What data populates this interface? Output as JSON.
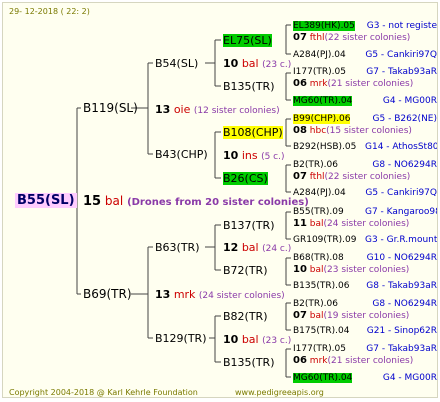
{
  "header": {
    "date": "29- 12-2018 ( 22: 2)"
  },
  "root": {
    "name": "B55(SL)",
    "count": "15",
    "race": "bal",
    "note": "(Drones from 20 sister colonies)"
  },
  "g1": {
    "top": "B119(SL)",
    "bottom": "B69(TR)"
  },
  "g2": [
    "B54(SL)",
    "B43(CHP)",
    "B63(TR)",
    "B129(TR)"
  ],
  "g2n": [
    {
      "n": "13",
      "r": "oie",
      "s": "(12 sister colonies)"
    },
    {
      "n": "13",
      "r": "mrk",
      "s": "(24 sister colonies)"
    }
  ],
  "g3": [
    "EL75(SL)",
    "B135(TR)",
    "B108(CHP)",
    "B26(CS)",
    "B137(TR)",
    "B72(TR)",
    "B82(TR)",
    "B135(TR)"
  ],
  "g3n": [
    {
      "n": "10",
      "r": "bal",
      "s": "(23 c.)"
    },
    {
      "n": "10",
      "r": "ins",
      "s": "(5 c.)"
    },
    {
      "n": "12",
      "r": "bal",
      "s": "(24 c.)"
    },
    {
      "n": "10",
      "r": "bal",
      "s": "(23 c.)"
    }
  ],
  "leaves": [
    {
      "type": "id",
      "name": "EL389(HK).05",
      "hl": "gn",
      "right": "G3 - not registe"
    },
    {
      "type": "note",
      "n": "07",
      "r": "fthl",
      "s": "(22 sister colonies)"
    },
    {
      "type": "id",
      "name": "A284(PJ).04",
      "hl": "",
      "right": "G5 - Cankiri97Q"
    },
    {
      "type": "id",
      "name": "I177(TR).05",
      "hl": "",
      "right": "G7 - Takab93aR"
    },
    {
      "type": "note",
      "n": "06",
      "r": "mrk",
      "s": "(21 sister colonies)"
    },
    {
      "type": "id",
      "name": "MG60(TR).04",
      "hl": "gn",
      "right": "G4 - MG00R"
    },
    {
      "type": "id",
      "name": "B99(CHP).06",
      "hl": "yl",
      "right": "G5 - B262(NE)"
    },
    {
      "type": "note",
      "n": "08",
      "r": "hbc",
      "s": "(15 sister colonies)"
    },
    {
      "type": "id",
      "name": "B292(HSB).05",
      "hl": "",
      "right": "G14 - AthosSt80R"
    },
    {
      "type": "id",
      "name": "B2(TR).06",
      "hl": "",
      "right": "G8 - NO6294R"
    },
    {
      "type": "note",
      "n": "07",
      "r": "fthl",
      "s": "(22 sister colonies)"
    },
    {
      "type": "id",
      "name": "A284(PJ).04",
      "hl": "",
      "right": "G5 - Cankiri97Q"
    },
    {
      "type": "id",
      "name": "B55(TR).09",
      "hl": "",
      "right": "G7 - Kangaroo98R"
    },
    {
      "type": "note",
      "n": "11",
      "r": "bal",
      "s": "(24 sister colonies)"
    },
    {
      "type": "id",
      "name": "GR109(TR).09",
      "hl": "",
      "right": "G3 - Gr.R.mounta"
    },
    {
      "type": "id",
      "name": "B68(TR).08",
      "hl": "",
      "right": "G10 - NO6294R"
    },
    {
      "type": "note",
      "n": "10",
      "r": "bal",
      "s": "(23 sister colonies)"
    },
    {
      "type": "id",
      "name": "B135(TR).06",
      "hl": "",
      "right": "G8 - Takab93aR"
    },
    {
      "type": "id",
      "name": "B2(TR).06",
      "hl": "",
      "right": "G8 - NO6294R"
    },
    {
      "type": "note",
      "n": "07",
      "r": "bal",
      "s": "(19 sister colonies)"
    },
    {
      "type": "id",
      "name": "B175(TR).04",
      "hl": "",
      "right": "G21 - Sinop62R"
    },
    {
      "type": "id",
      "name": "I177(TR).05",
      "hl": "",
      "right": "G7 - Takab93aR"
    },
    {
      "type": "note",
      "n": "06",
      "r": "mrk",
      "s": "(21 sister colonies)"
    },
    {
      "type": "id",
      "name": "MG60(TR).04",
      "hl": "gn",
      "right": "G4 - MG00R"
    }
  ],
  "footer": {
    "copyright": "Copyright 2004-2018 @ Karl Kehrle Foundation",
    "site": "www.pedigreeapis.org"
  }
}
